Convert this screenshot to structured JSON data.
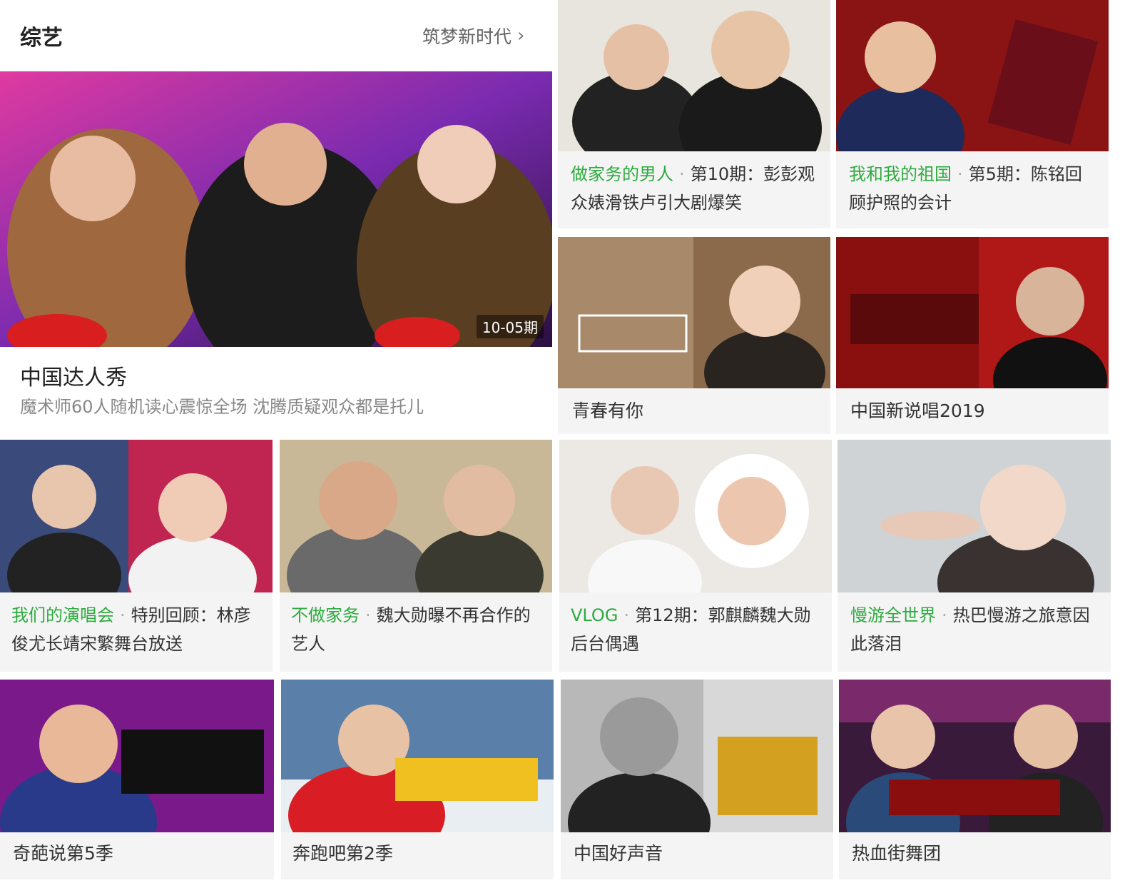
{
  "section": {
    "title": "综艺",
    "more_label": "筑梦新时代",
    "more_icon": "chevron-right-icon"
  },
  "colors": {
    "accent": "#2dab3f"
  },
  "feature": {
    "title": "中国达人秀",
    "desc": "魔术师60人随机读心震惊全场 沈腾质疑观众都是托儿",
    "badge": "10-05期"
  },
  "cards": [
    {
      "tag": "做家务的男人",
      "text": "第10期：彭彭观众婊滑铁卢引大剧爆笑"
    },
    {
      "tag": "我和我的祖国",
      "text": "第5期：陈铭回顾护照的会计"
    },
    {
      "title": "青春有你"
    },
    {
      "title": "中国新说唱2019"
    },
    {
      "tag": "我们的演唱会",
      "text": "特别回顾：林彦俊尤长靖宋繁舞台放送"
    },
    {
      "tag": "不做家务",
      "text": "魏大勋曝不再合作的艺人"
    },
    {
      "tag": "VLOG",
      "text": "第12期：郭麒麟魏大勋后台偶遇"
    },
    {
      "tag": "慢游全世界",
      "text": "热巴慢游之旅意因此落泪"
    },
    {
      "title": "奇葩说第5季"
    },
    {
      "title": "奔跑吧第2季"
    },
    {
      "title": "中国好声音"
    },
    {
      "title": "热血街舞团"
    }
  ]
}
